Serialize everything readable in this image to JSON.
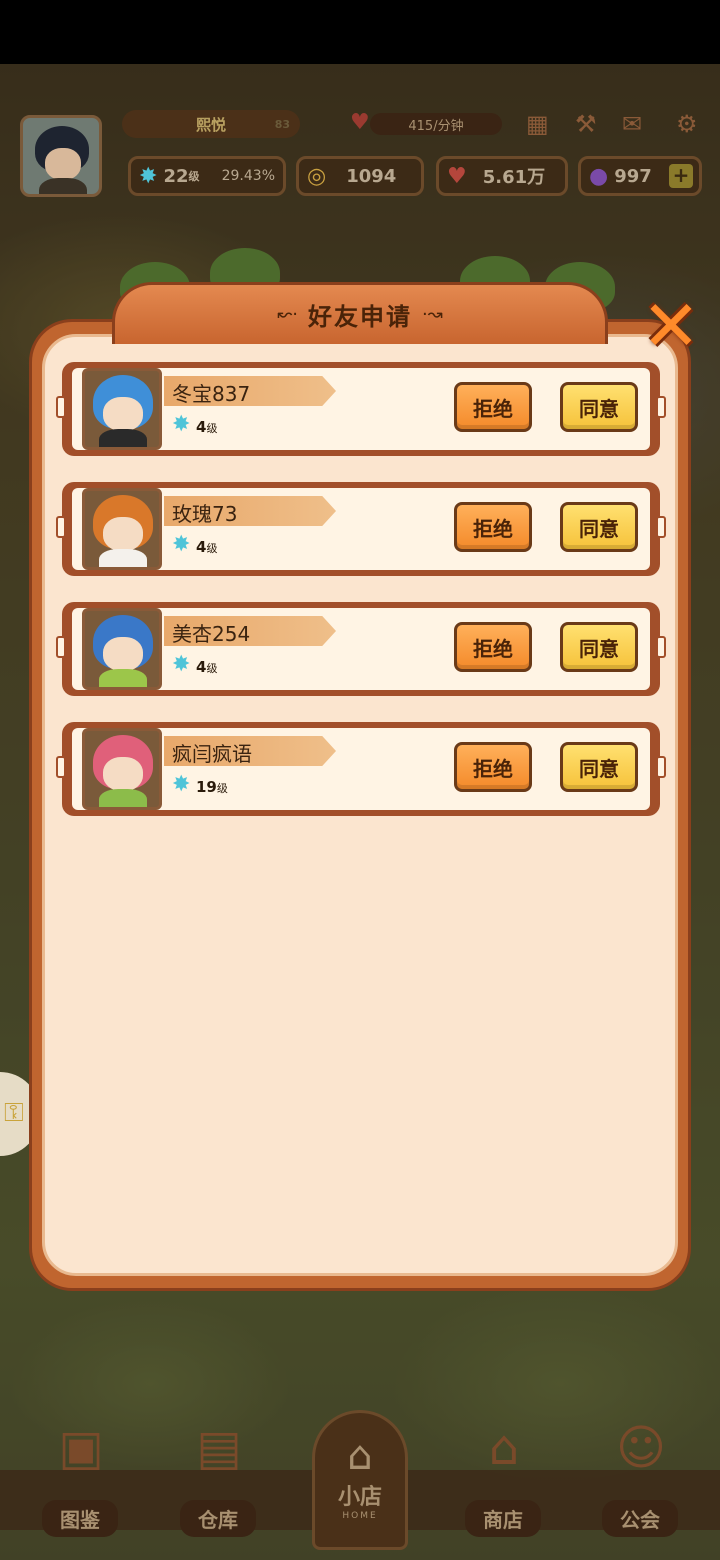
{
  "hud": {
    "player_name": "熙悦",
    "player_name_tail": "83",
    "rate": "415/分钟",
    "level": "22",
    "level_unit": "级",
    "level_progress": "29.43%",
    "coins": "1094",
    "hearts": "5.61万",
    "gems": "997"
  },
  "dialog": {
    "title": "好友申请",
    "title_ornament_left": "↜·",
    "title_ornament_right": "·↝",
    "close_symbol": "✕",
    "reject_label": "拒绝",
    "accept_label": "同意",
    "level_unit": "级"
  },
  "requests": [
    {
      "name": "冬宝837",
      "level": "4",
      "hair_color": "#3f8fd8",
      "shirt_color": "#2a2a2a"
    },
    {
      "name": "玫瑰73",
      "level": "4",
      "hair_color": "#d9782a",
      "shirt_color": "#f4f1ec"
    },
    {
      "name": "美杏254",
      "level": "4",
      "hair_color": "#3a78c8",
      "shirt_color": "#9cc64a"
    },
    {
      "name": "疯闫疯语",
      "level": "19",
      "hair_color": "#e0607a",
      "shirt_color": "#8cbc4a"
    }
  ],
  "nav": {
    "items": [
      {
        "label": "图鉴",
        "icon": "book-icon"
      },
      {
        "label": "仓库",
        "icon": "box-icon"
      },
      {
        "label": "商店",
        "icon": "shop-icon"
      },
      {
        "label": "公会",
        "icon": "guild-icon"
      }
    ],
    "home_label": "小店",
    "home_sub": "HOME"
  },
  "colors": {
    "modal_frame": "#c0652f",
    "modal_bg": "#fbe5cf",
    "reject_button": "#f48a2a",
    "accept_button": "#f6c23a",
    "level_star": "#4fc4d8"
  }
}
